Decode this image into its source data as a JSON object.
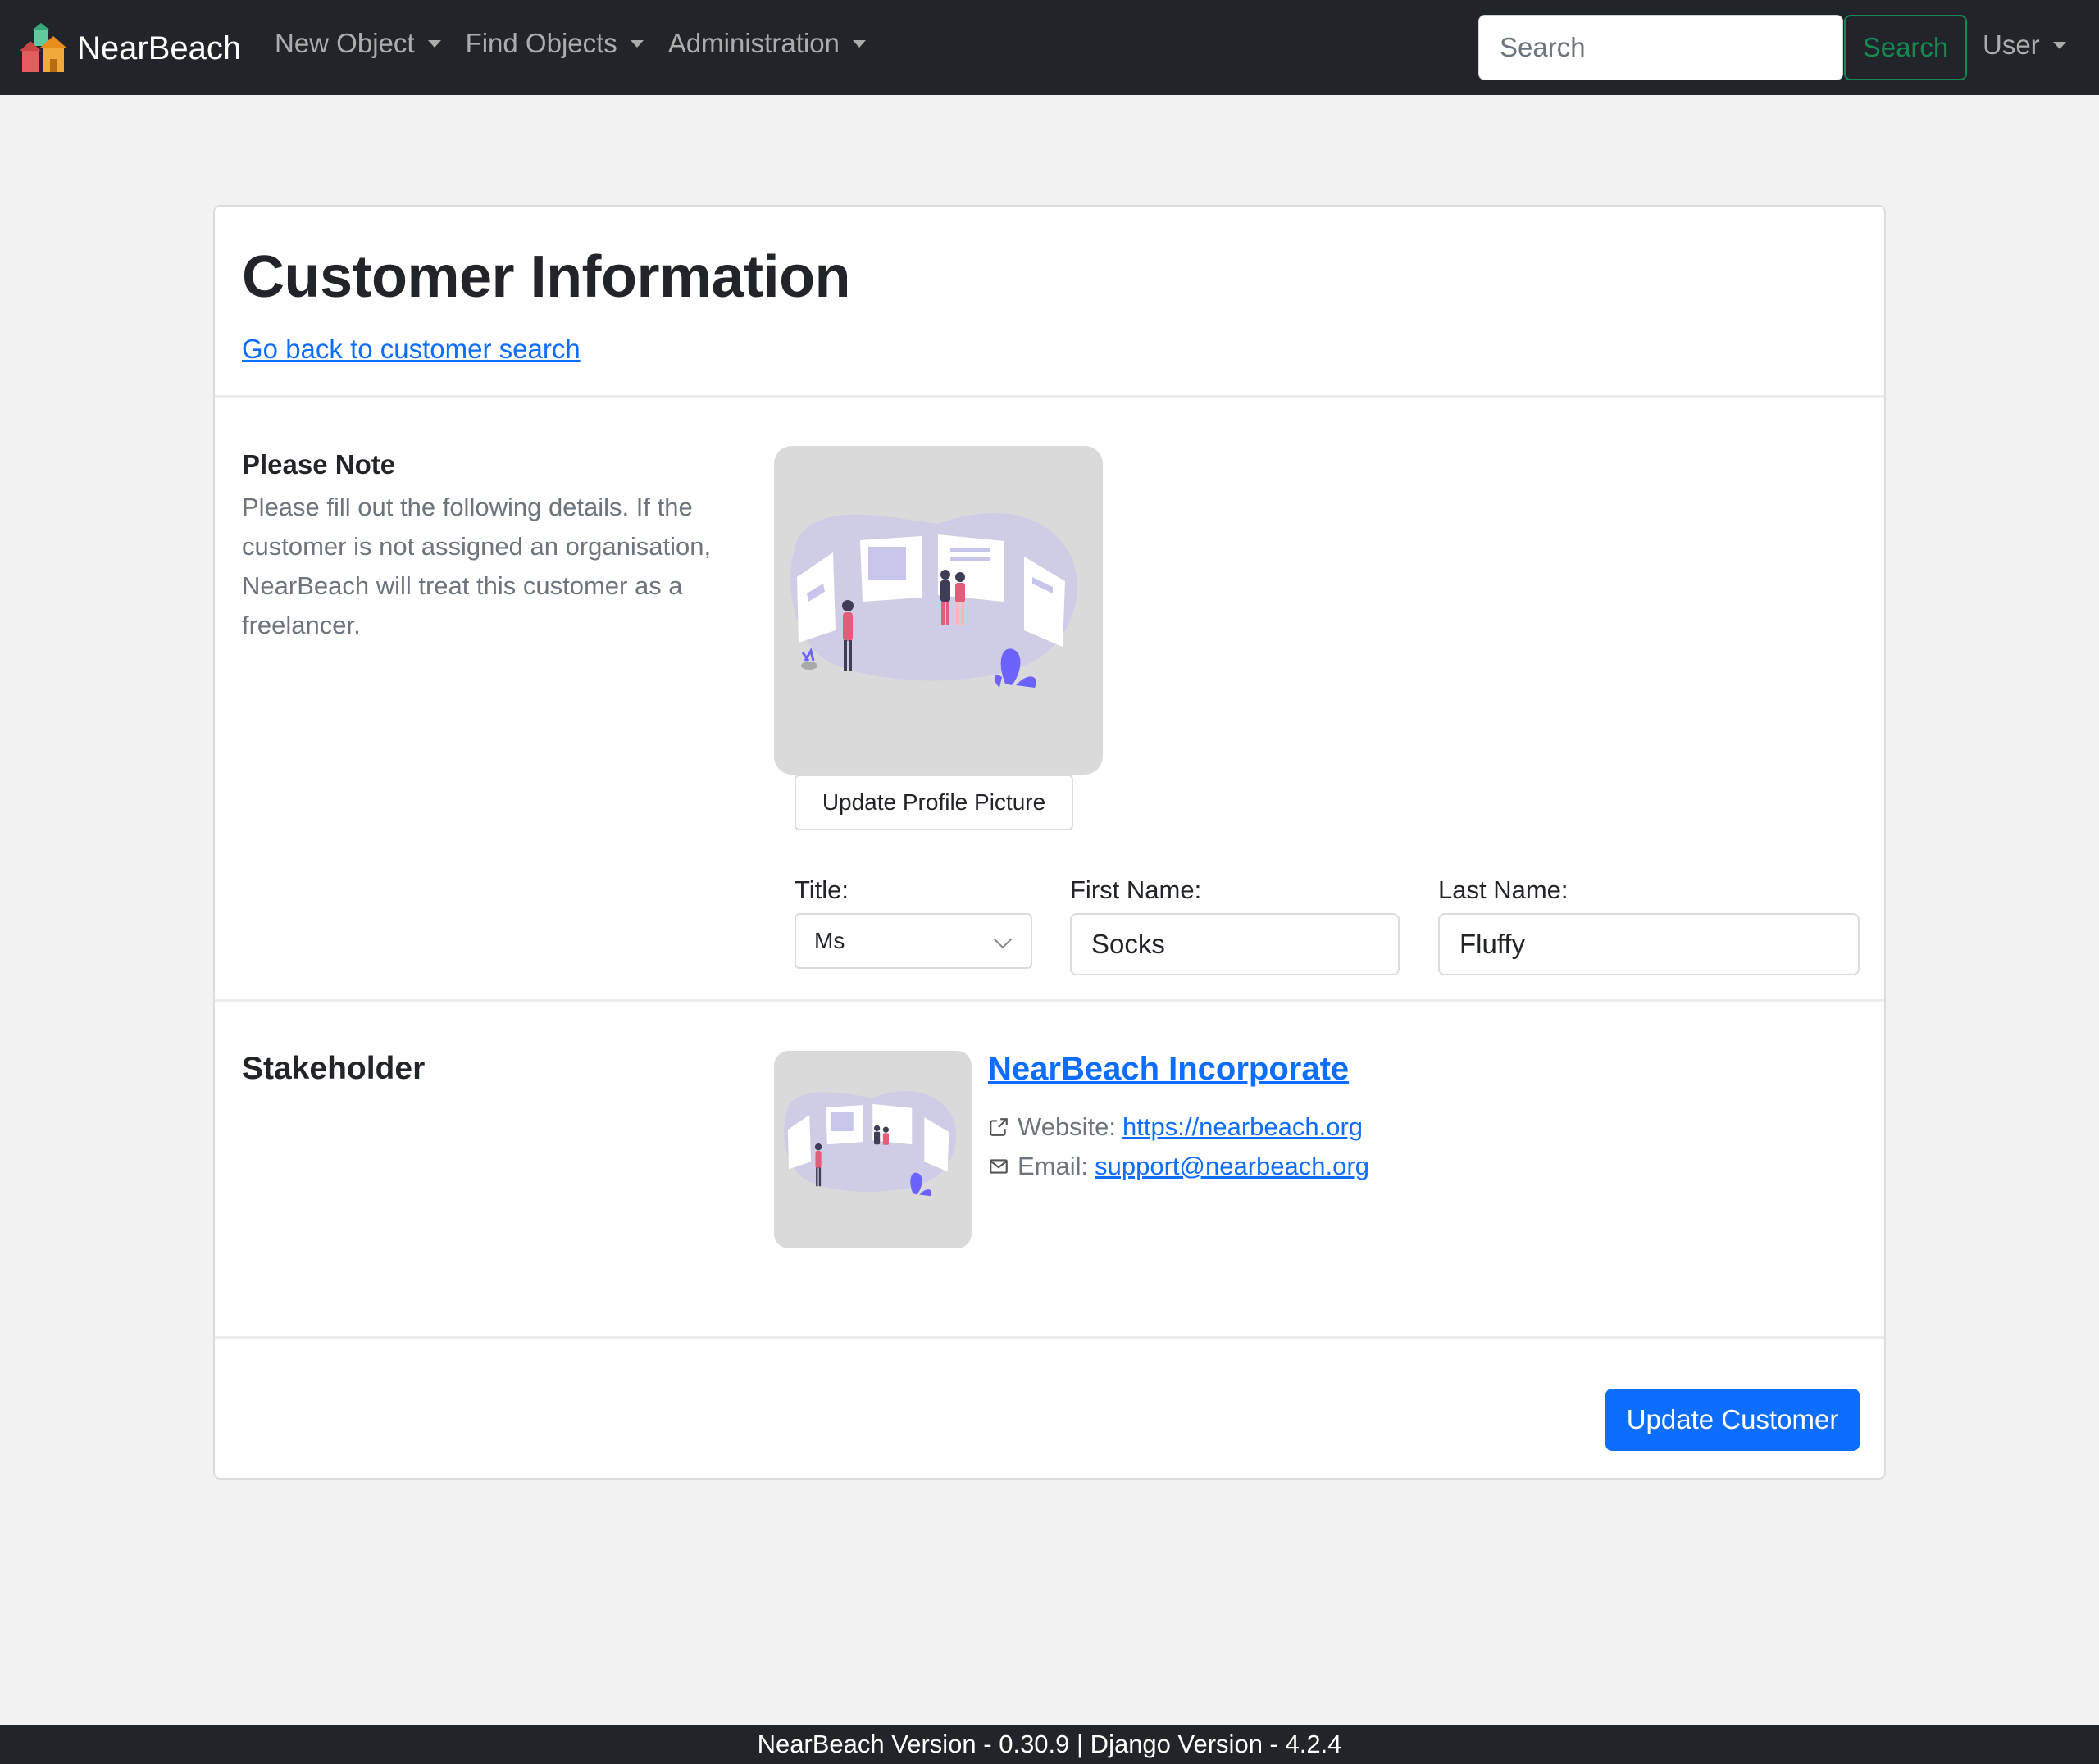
{
  "nav": {
    "brand": "NearBeach",
    "menus": [
      "New Object",
      "Find Objects",
      "Administration"
    ],
    "search_placeholder": "Search",
    "search_button": "Search",
    "user_menu": "User"
  },
  "page": {
    "title": "Customer Information",
    "back_link": "Go back to customer search"
  },
  "note": {
    "heading": "Please Note",
    "text": "Please fill out the following details. If the customer is not assigned an organisation, NearBeach will treat this customer as a freelancer."
  },
  "profile": {
    "update_picture_button": "Update Profile Picture"
  },
  "form": {
    "title_label": "Title:",
    "title_value": "Ms",
    "first_name_label": "First Name:",
    "first_name_value": "Socks",
    "last_name_label": "Last Name:",
    "last_name_value": "Fluffy"
  },
  "stakeholder": {
    "heading": "Stakeholder",
    "organisation_name": "NearBeach Incorporate",
    "website_label": "Website:",
    "website": "https://nearbeach.org",
    "email_label": "Email:",
    "email": "support@nearbeach.org"
  },
  "actions": {
    "update_button": "Update Customer"
  },
  "footer": {
    "text": "NearBeach Version - 0.30.9 | Django Version - 4.2.4"
  },
  "colors": {
    "navbar": "#212529",
    "primary": "#0d6efd",
    "success": "#198754",
    "illustration_accent": "#6c63ff"
  }
}
